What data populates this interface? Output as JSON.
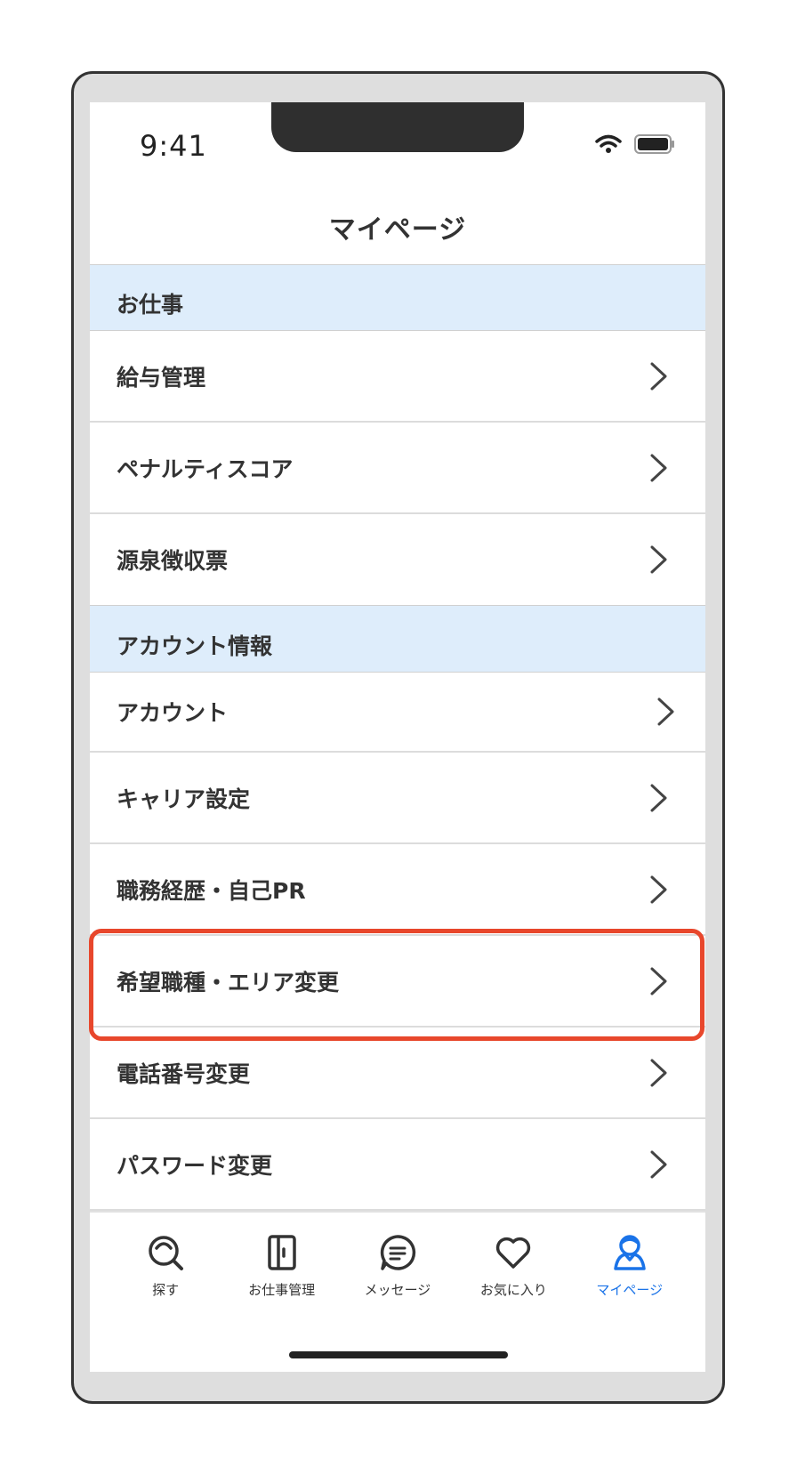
{
  "status_bar": {
    "time": "9:41"
  },
  "header": {
    "title": "マイページ"
  },
  "sections": [
    {
      "title": "お仕事",
      "items": [
        "給与管理",
        "ペナルティスコア",
        "源泉徴収票"
      ]
    },
    {
      "title": "アカウント情報",
      "items": [
        "アカウント",
        "キャリア設定",
        "職務経歴・自己PR",
        "希望職種・エリア変更",
        "電話番号変更",
        "パスワード変更"
      ]
    }
  ],
  "tabs": [
    {
      "label": "探す",
      "icon": "search-icon"
    },
    {
      "label": "お仕事管理",
      "icon": "job-book-icon"
    },
    {
      "label": "メッセージ",
      "icon": "message-icon"
    },
    {
      "label": "お気に入り",
      "icon": "heart-icon"
    },
    {
      "label": "マイページ",
      "icon": "user-icon",
      "active": true
    }
  ],
  "colors": {
    "accent": "#1a73e8",
    "section_bg": "#deedfb",
    "highlight": "#e8472c"
  }
}
